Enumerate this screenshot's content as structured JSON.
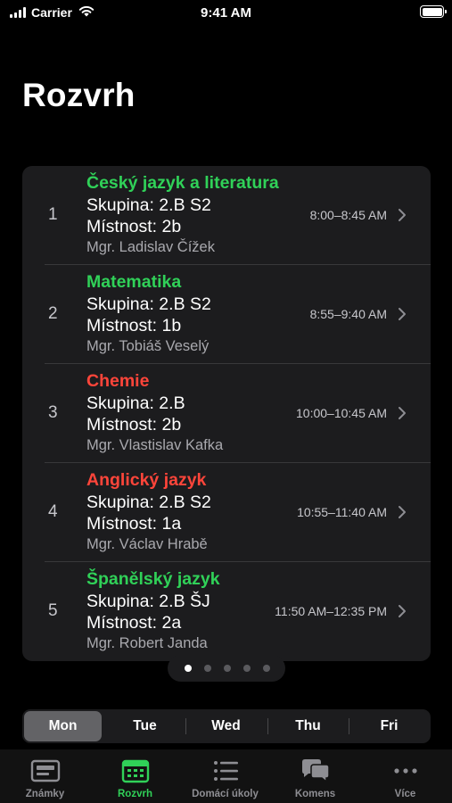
{
  "status_bar": {
    "carrier": "Carrier",
    "time": "9:41 AM"
  },
  "page": {
    "title": "Rozvrh"
  },
  "lessons": [
    {
      "number": "1",
      "subject": "Český jazyk a literatura",
      "subject_color": "#30d158",
      "group": "Skupina: 2.B S2",
      "room": "Místnost: 2b",
      "teacher": "Mgr. Ladislav Čížek",
      "time": "8:00–8:45 AM"
    },
    {
      "number": "2",
      "subject": "Matematika",
      "subject_color": "#30d158",
      "group": "Skupina: 2.B S2",
      "room": "Místnost: 1b",
      "teacher": "Mgr. Tobiáš Veselý",
      "time": "8:55–9:40 AM"
    },
    {
      "number": "3",
      "subject": "Chemie",
      "subject_color": "#ff453a",
      "group": "Skupina: 2.B",
      "room": "Místnost: 2b",
      "teacher": "Mgr. Vlastislav Kafka",
      "time": "10:00–10:45 AM"
    },
    {
      "number": "4",
      "subject": "Anglický jazyk",
      "subject_color": "#ff453a",
      "group": "Skupina: 2.B S2",
      "room": "Místnost: 1a",
      "teacher": "Mgr. Václav Hrabě",
      "time": "10:55–11:40 AM"
    },
    {
      "number": "5",
      "subject": "Španělský jazyk",
      "subject_color": "#30d158",
      "group": "Skupina: 2.B ŠJ",
      "room": "Místnost: 2a",
      "teacher": "Mgr. Robert Janda",
      "time": "11:50 AM–12:35 PM"
    }
  ],
  "pager": {
    "page_count": 5,
    "current_page": 1
  },
  "days": {
    "items": [
      "Mon",
      "Tue",
      "Wed",
      "Thu",
      "Fri"
    ],
    "selected": "Mon"
  },
  "tabbar": {
    "items": [
      {
        "label": "Známky",
        "icon": "grades-icon"
      },
      {
        "label": "Rozvrh",
        "icon": "calendar-icon"
      },
      {
        "label": "Domácí úkoly",
        "icon": "list-icon"
      },
      {
        "label": "Komens",
        "icon": "chat-bubbles-icon"
      },
      {
        "label": "Více",
        "icon": "more-icon"
      }
    ],
    "active": "Rozvrh"
  },
  "colors": {
    "accent": "#30d158",
    "alert": "#ff453a",
    "background": "#000000",
    "card": "#1c1c1e"
  }
}
